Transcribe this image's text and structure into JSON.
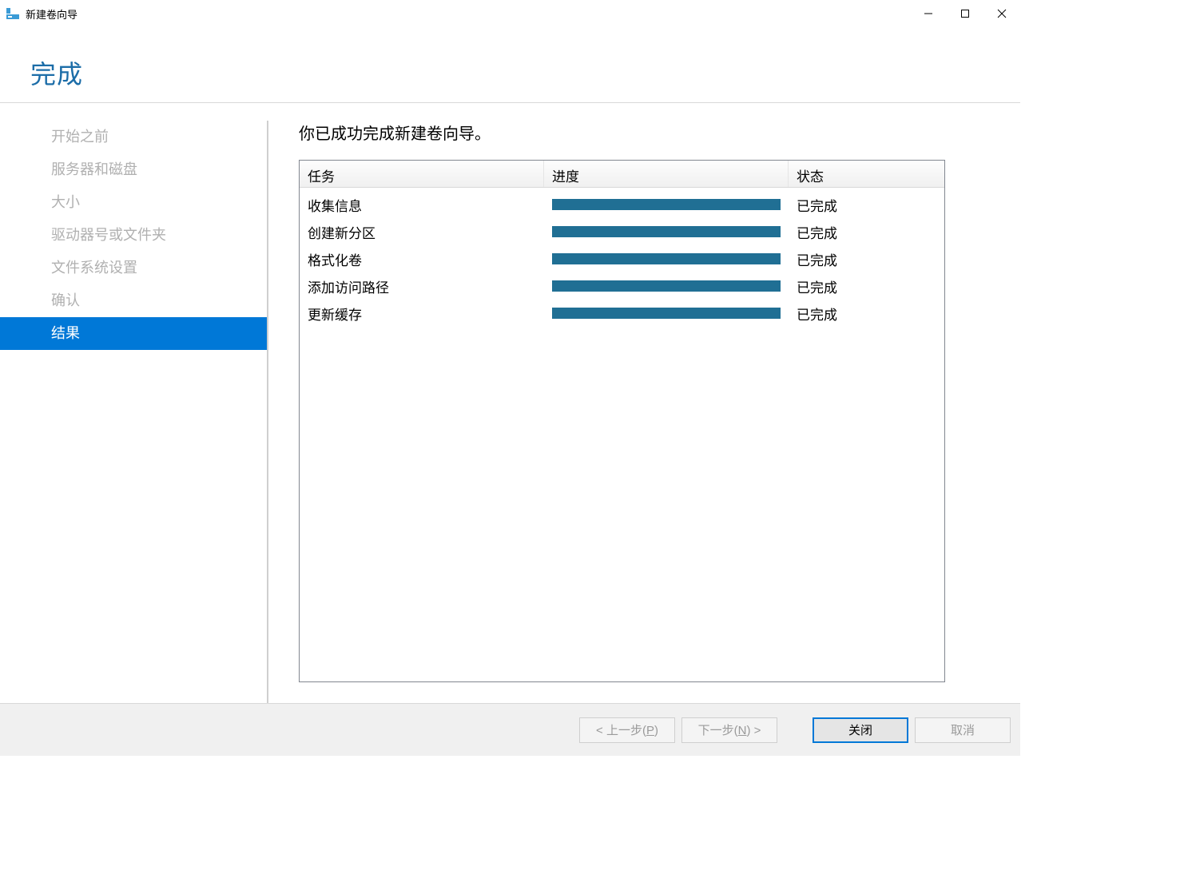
{
  "window": {
    "title": "新建卷向导"
  },
  "heading": "完成",
  "sidebar": {
    "items": [
      {
        "label": "开始之前"
      },
      {
        "label": "服务器和磁盘"
      },
      {
        "label": "大小"
      },
      {
        "label": "驱动器号或文件夹"
      },
      {
        "label": "文件系统设置"
      },
      {
        "label": "确认"
      },
      {
        "label": "结果",
        "active": true
      }
    ]
  },
  "main": {
    "description": "你已成功完成新建卷向导。",
    "columns": {
      "task": "任务",
      "progress": "进度",
      "status": "状态"
    },
    "rows": [
      {
        "task": "收集信息",
        "progress": 100,
        "status": "已完成"
      },
      {
        "task": "创建新分区",
        "progress": 100,
        "status": "已完成"
      },
      {
        "task": "格式化卷",
        "progress": 100,
        "status": "已完成"
      },
      {
        "task": "添加访问路径",
        "progress": 100,
        "status": "已完成"
      },
      {
        "task": "更新缓存",
        "progress": 100,
        "status": "已完成"
      }
    ]
  },
  "footer": {
    "prev_prefix": "< 上一步(",
    "prev_key": "P",
    "prev_suffix": ")",
    "next_prefix": "下一步(",
    "next_key": "N",
    "next_suffix": ") >",
    "close": "关闭",
    "cancel": "取消"
  }
}
